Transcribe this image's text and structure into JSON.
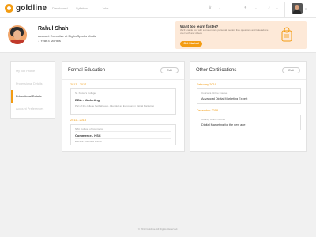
{
  "brand": {
    "name": "goldline",
    "accent": "#f39c12"
  },
  "nav": {
    "links": [
      "Dashboard",
      "Syllabus",
      "Jobs"
    ],
    "crown_count": "0",
    "coin_count": "0",
    "notification_count": "0",
    "icons": [
      "crown-icon",
      "coin-icon",
      "bell-icon"
    ]
  },
  "profile": {
    "name": "Rahul Shah",
    "role": "Account Executive at DigitalSparks Media",
    "experience": "1 Year 4 Months"
  },
  "promo": {
    "title": "Want too learn faster?",
    "text": "We'll enable you with a one-on-one personal mentor, free questions and take advice over both and videos",
    "button": "Get Started"
  },
  "side_menu": {
    "items": [
      "My Job Profile",
      "Professional Details",
      "Educational Details",
      "Account Preferences"
    ],
    "active": "Educational Details"
  },
  "formal_education": {
    "title": "Formal Education",
    "edit": "Edit",
    "entries": [
      {
        "years": "2013 - 2017",
        "institution": "St. Xavier's College",
        "degree": "BBA - Marketing",
        "description": "Part of the college football team. Attended an European in Digital Marketing"
      },
      {
        "years": "2011 - 2013",
        "institution": "N.M. College of Commerce",
        "degree": "Commerce - HSC",
        "description": "Elective : Maths & French"
      }
    ]
  },
  "other_certifications": {
    "title": "Other Certifications",
    "edit": "Edit",
    "entries": [
      {
        "date": "February 2019",
        "provider": "Coursera Online Course",
        "name": "Advanced Digital Marketing Expert"
      },
      {
        "date": "December 2018",
        "provider": "Udacity Online Course",
        "name": "Digital Marketing for the new age"
      }
    ]
  },
  "footer": "© 2019 Goldline. All Rights Reserved."
}
